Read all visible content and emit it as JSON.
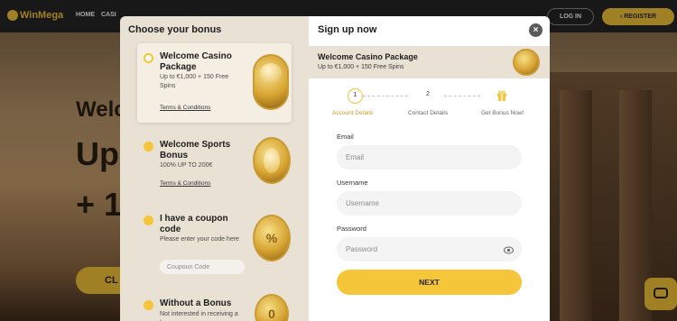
{
  "site": {
    "logo": "WinMega",
    "nav": [
      "HOME",
      "CASI"
    ],
    "login_label": "LOG IN",
    "register_label": "REGISTER",
    "headline_1": "Welc",
    "headline_2": "Up",
    "headline_3": "+ 1",
    "cta_label": "CL"
  },
  "bonus_panel": {
    "title": "Choose your bonus",
    "items": [
      {
        "title": "Welcome Casino Package",
        "desc": "Up to €1,000 + 150 Free Spins",
        "terms": "Terms & Conditions",
        "selected": true,
        "icon": "chips-icon"
      },
      {
        "title": "Welcome Sports Bonus",
        "desc": "100% UP TO 200€",
        "terms": "Terms & Conditions",
        "selected": false,
        "icon": "sports-ball-icon"
      },
      {
        "title": "I have a coupon code",
        "desc": "Please enter your code here",
        "input_placeholder": "Coupoun Code",
        "selected": false,
        "icon": "coupon-icon"
      },
      {
        "title": "Without a Bonus",
        "desc": "Not interested in receiving a bonus",
        "selected": false,
        "icon": "zero-coin-icon"
      }
    ]
  },
  "signup": {
    "title": "Sign up now",
    "close_icon": "close-icon",
    "package": {
      "title": "Welcome Casino Package",
      "desc": "Up to €1,000 + 150 Free Spins"
    },
    "steps": [
      {
        "num": "1",
        "label": "Account Details",
        "active": true
      },
      {
        "num": "2",
        "label": "Contact Details",
        "active": false
      },
      {
        "num": "",
        "label": "Get Bonus Now!",
        "active": false,
        "icon": "gift-icon"
      }
    ],
    "email": {
      "label": "Email",
      "placeholder": "Email"
    },
    "username": {
      "label": "Username",
      "placeholder": "Username"
    },
    "password": {
      "label": "Password",
      "placeholder": "Password",
      "icon": "eye-icon"
    },
    "next_label": "NEXT"
  },
  "colors": {
    "accent": "#f5c53a",
    "panel": "#e9e1d3"
  }
}
